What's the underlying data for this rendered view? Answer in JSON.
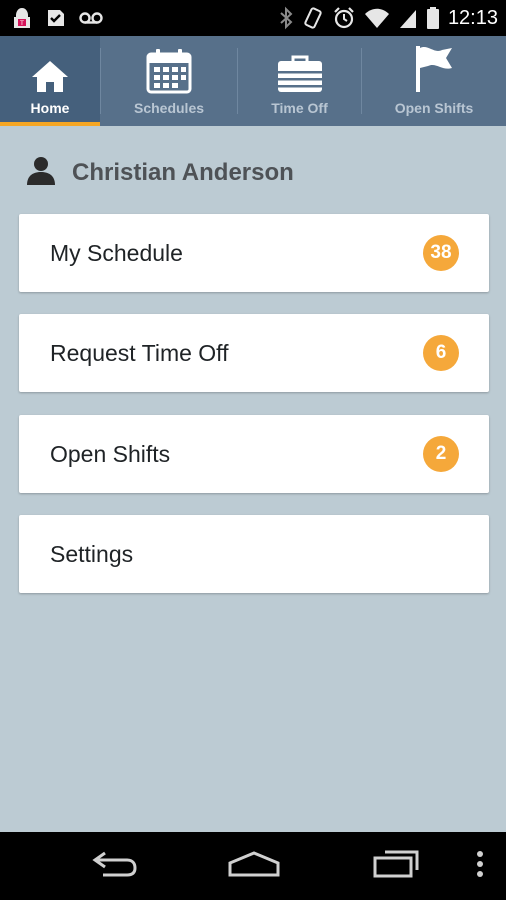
{
  "status_bar": {
    "time": "12:13",
    "left_icons": [
      "tmobile-icon",
      "check-badge-icon",
      "voicemail-icon"
    ],
    "right_icons": [
      "bluetooth-icon",
      "vibrate-icon",
      "alarm-icon",
      "wifi-icon",
      "signal-icon",
      "battery-icon"
    ]
  },
  "tabs": [
    {
      "label": "Home",
      "icon": "home-icon",
      "active": true
    },
    {
      "label": "Schedules",
      "icon": "calendar-icon",
      "active": false
    },
    {
      "label": "Time Off",
      "icon": "briefcase-icon",
      "active": false
    },
    {
      "label": "Open Shifts",
      "icon": "flag-icon",
      "active": false
    }
  ],
  "user": {
    "name": "Christian Anderson",
    "icon": "person-icon"
  },
  "menu": [
    {
      "label": "My Schedule",
      "badge": "38"
    },
    {
      "label": "Request Time Off",
      "badge": "6"
    },
    {
      "label": "Open Shifts",
      "badge": "2"
    },
    {
      "label": "Settings",
      "badge": null
    }
  ],
  "colors": {
    "tab_bar": "#57708a",
    "tab_active": "#45607c",
    "accent": "#f5a623",
    "badge": "#f5a83a",
    "background": "#bccbd3"
  },
  "nav_bar": [
    "back-icon",
    "home-nav-icon",
    "recents-icon",
    "overflow-menu-icon"
  ]
}
